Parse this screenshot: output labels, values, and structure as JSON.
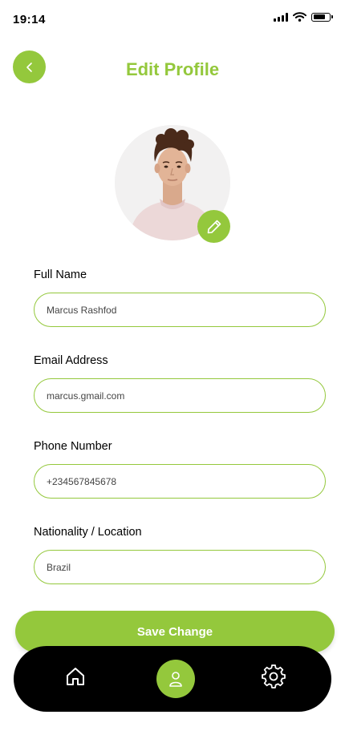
{
  "status_bar": {
    "time": "19:14",
    "battery_level": 0.8
  },
  "header": {
    "title": "Edit Profile",
    "back_icon": "chevron-left-icon"
  },
  "profile": {
    "edit_icon": "pencil-icon"
  },
  "fields": {
    "full_name": {
      "label": "Full  Name",
      "value": "Marcus Rashfod"
    },
    "email": {
      "label": "Email Address",
      "value": "marcus.gmail.com"
    },
    "phone": {
      "label": "Phone Number",
      "value": "+234567845678"
    },
    "location": {
      "label": "Nationality / Location",
      "value": "Brazil"
    }
  },
  "actions": {
    "save_label": "Save Change"
  },
  "bottom_nav": {
    "items": [
      {
        "icon": "home-icon",
        "active": false
      },
      {
        "icon": "user-icon",
        "active": true
      },
      {
        "icon": "gear-icon",
        "active": false
      }
    ]
  },
  "colors": {
    "accent": "#94c83c",
    "nav_background": "#000000",
    "text": "#000000"
  }
}
